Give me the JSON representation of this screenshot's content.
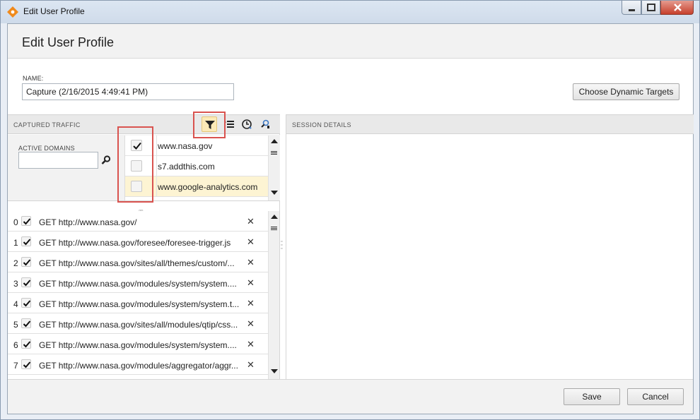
{
  "window": {
    "title": "Edit User Profile"
  },
  "page": {
    "title": "Edit User Profile"
  },
  "name_field": {
    "label": "NAME:",
    "value": "Capture (2/16/2015 4:49:41 PM)"
  },
  "buttons": {
    "dynamic_targets": "Choose Dynamic Targets",
    "save": "Save",
    "cancel": "Cancel"
  },
  "captured_traffic": {
    "header": "CAPTURED TRAFFIC",
    "toolbar_icons": [
      "filter-icon",
      "list-icon",
      "clock-icon",
      "find-icon"
    ],
    "active_domains_label": "ACTIVE DOMAINS",
    "domains": [
      {
        "name": "www.nasa.gov",
        "checked": true
      },
      {
        "name": "s7.addthis.com",
        "checked": false
      },
      {
        "name": "www.google-analytics.com",
        "checked": false
      }
    ],
    "requests": [
      {
        "index": "0",
        "url": "GET http://www.nasa.gov/"
      },
      {
        "index": "1",
        "url": "GET http://www.nasa.gov/foresee/foresee-trigger.js"
      },
      {
        "index": "2",
        "url": "GET http://www.nasa.gov/sites/all/themes/custom/..."
      },
      {
        "index": "3",
        "url": "GET http://www.nasa.gov/modules/system/system...."
      },
      {
        "index": "4",
        "url": "GET http://www.nasa.gov/modules/system/system.t..."
      },
      {
        "index": "5",
        "url": "GET http://www.nasa.gov/sites/all/modules/qtip/css..."
      },
      {
        "index": "6",
        "url": "GET http://www.nasa.gov/modules/system/system...."
      },
      {
        "index": "7",
        "url": "GET http://www.nasa.gov/modules/aggregator/aggr..."
      }
    ]
  },
  "session_details": {
    "header": "SESSION DETAILS"
  },
  "colors": {
    "highlight": "#d9534f",
    "filter_active": "#fbe9b7",
    "row_highlight": "#fdf4d3"
  }
}
